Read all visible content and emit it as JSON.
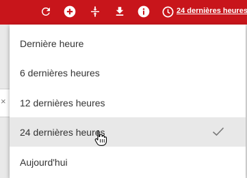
{
  "colors": {
    "toolbar_background": "#c8151b",
    "toolbar_foreground": "#ffffff",
    "menu_text": "#333333",
    "selected_background": "#e8e8e8",
    "check_color": "#777777"
  },
  "toolbar": {
    "icons": [
      "refresh-icon",
      "add-circle-icon",
      "collapse-icon",
      "download-icon",
      "info-icon",
      "clock-icon"
    ],
    "time_range_label": "24 dernières heures"
  },
  "dropdown": {
    "items": [
      {
        "label": "Dernière heure",
        "selected": false
      },
      {
        "label": "6 dernières heures",
        "selected": false
      },
      {
        "label": "12 dernières heures",
        "selected": false
      },
      {
        "label": "24 dernières heures",
        "selected": true
      },
      {
        "label": "Aujourd'hui",
        "selected": false
      }
    ]
  },
  "background": {
    "close_glyph": "×"
  }
}
